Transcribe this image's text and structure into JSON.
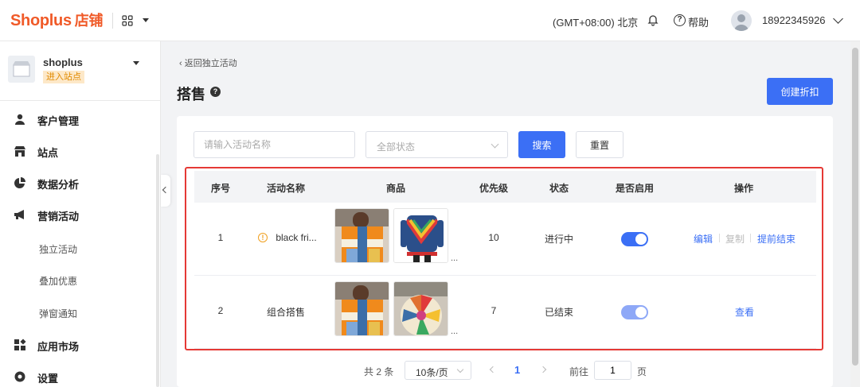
{
  "header": {
    "logo_text": "Shoplus",
    "logo_cn": "店铺",
    "timezone": "(GMT+08:00) 北京",
    "help_label": "帮助",
    "help_symbol": "?",
    "user_phone": "18922345926"
  },
  "sidebar": {
    "store_name": "shoplus",
    "store_tag": "进入站点",
    "items": [
      {
        "label": "客户管理",
        "icon": "user-icon"
      },
      {
        "label": "站点",
        "icon": "store-icon"
      },
      {
        "label": "数据分析",
        "icon": "pie-chart-icon"
      },
      {
        "label": "营销活动",
        "icon": "megaphone-icon"
      },
      {
        "label": "应用市场",
        "icon": "apps-icon"
      },
      {
        "label": "设置",
        "icon": "gear-icon"
      }
    ],
    "sub_items": [
      "独立活动",
      "叠加优惠",
      "弹窗通知"
    ]
  },
  "main": {
    "back_link": "返回独立活动",
    "title": "搭售",
    "title_help": "?",
    "create_button": "创建折扣",
    "filters": {
      "name_placeholder": "请输入活动名称",
      "status_placeholder": "全部状态",
      "search_button": "搜索",
      "reset_button": "重置"
    },
    "table": {
      "headers": [
        "序号",
        "活动名称",
        "商品",
        "优先级",
        "状态",
        "是否启用",
        "操作"
      ],
      "rows": [
        {
          "index": "1",
          "name": "black fri...",
          "warning": true,
          "warning_symbol": "!",
          "more": "...",
          "priority": "10",
          "status": "进行中",
          "enabled": true,
          "actions": [
            {
              "label": "编辑",
              "enabled": true
            },
            {
              "label": "复制",
              "enabled": false
            },
            {
              "label": "提前结束",
              "enabled": true
            }
          ]
        },
        {
          "index": "2",
          "name": "组合搭售",
          "warning": false,
          "more": "...",
          "priority": "7",
          "status": "已结束",
          "enabled": true,
          "actions": [
            {
              "label": "查看",
              "enabled": true
            }
          ]
        }
      ]
    },
    "pagination": {
      "total": "共 2 条",
      "page_size": "10条/页",
      "current": "1",
      "goto_label": "前往",
      "goto_value": "1",
      "unit": "页"
    }
  },
  "colors": {
    "brand": "#f05a28",
    "primary": "#3b6ff5",
    "highlight": "#e53935",
    "warning": "#f0a020"
  }
}
